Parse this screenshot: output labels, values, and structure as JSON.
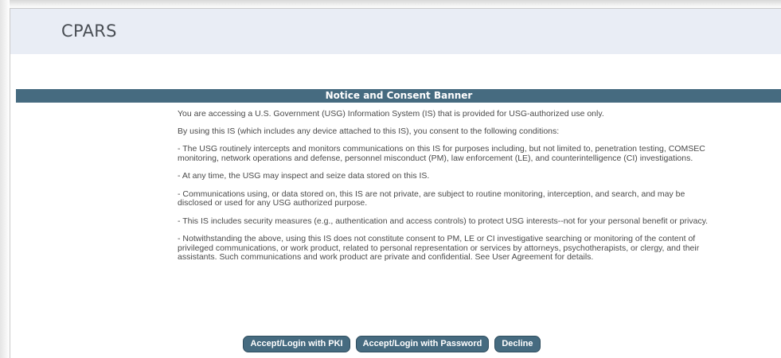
{
  "app": {
    "logo_text": "CPARS"
  },
  "banner": {
    "title": "Notice and Consent Banner"
  },
  "notice": {
    "paragraphs": [
      "You are accessing a U.S. Government (USG) Information System (IS) that is provided for USG-authorized use only.",
      "By using this IS (which includes any device attached to this IS), you consent to the following conditions:",
      "- The USG routinely intercepts and monitors communications on this IS for purposes including, but not limited to, penetration testing, COMSEC monitoring, network operations and defense, personnel misconduct (PM), law enforcement (LE), and counterintelligence (CI) investigations.",
      "- At any time, the USG may inspect and seize data stored on this IS.",
      "- Communications using, or data stored on, this IS are not private, are subject to routine monitoring, interception, and search, and may be disclosed or used for any USG authorized purpose.",
      "- This IS includes security measures (e.g., authentication and access controls) to protect USG interests--not for your personal benefit or privacy.",
      "- Notwithstanding the above, using this IS does not constitute consent to PM, LE or CI investigative searching or monitoring of the content of privileged communications, or work product, related to personal representation or services by attorneys, psychotherapists, or clergy, and their assistants. Such communications and work product are private and confidential. See User Agreement for details."
    ]
  },
  "buttons": {
    "pki_label": "Accept/Login with PKI",
    "password_label": "Accept/Login with Password",
    "decline_label": "Decline"
  },
  "colors": {
    "accent": "#466b80",
    "header_bg": "#e9edf5",
    "body_text": "#4a4a4a"
  }
}
